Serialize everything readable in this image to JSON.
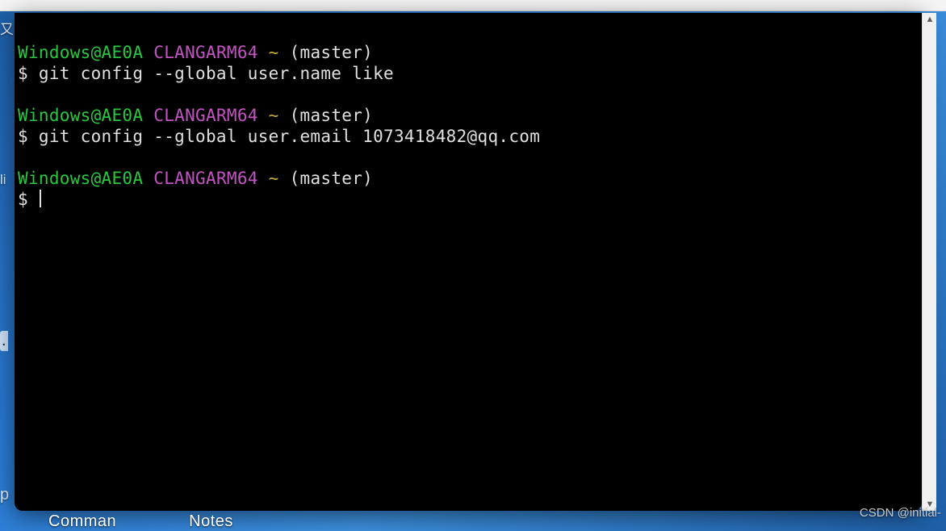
{
  "desktop": {
    "left_fragments": [
      "又..",
      "li",
      ".",
      "p"
    ],
    "taskbar_labels": [
      "Comman",
      "Notes"
    ],
    "watermark": "CSDN @initial-"
  },
  "terminal": {
    "blocks": [
      {
        "prompt": {
          "user_host": "Windows@AE0A",
          "env": "CLANGARM64",
          "path": "~",
          "branch": "(master)"
        },
        "command_prefix": "$ ",
        "command": "git config --global user.name like"
      },
      {
        "prompt": {
          "user_host": "Windows@AE0A",
          "env": "CLANGARM64",
          "path": "~",
          "branch": "(master)"
        },
        "command_prefix": "$ ",
        "command": "git config --global user.email 1073418482@qq.com"
      },
      {
        "prompt": {
          "user_host": "Windows@AE0A",
          "env": "CLANGARM64",
          "path": "~",
          "branch": "(master)"
        },
        "command_prefix": "$ ",
        "command": ""
      }
    ]
  },
  "colors": {
    "term_green": "#27c83f",
    "term_purple": "#c353c3",
    "term_yellow": "#c3a83a",
    "term_fg": "#e0e0e0",
    "term_bg": "#000000",
    "desktop_blue": "#2a7bd6"
  }
}
